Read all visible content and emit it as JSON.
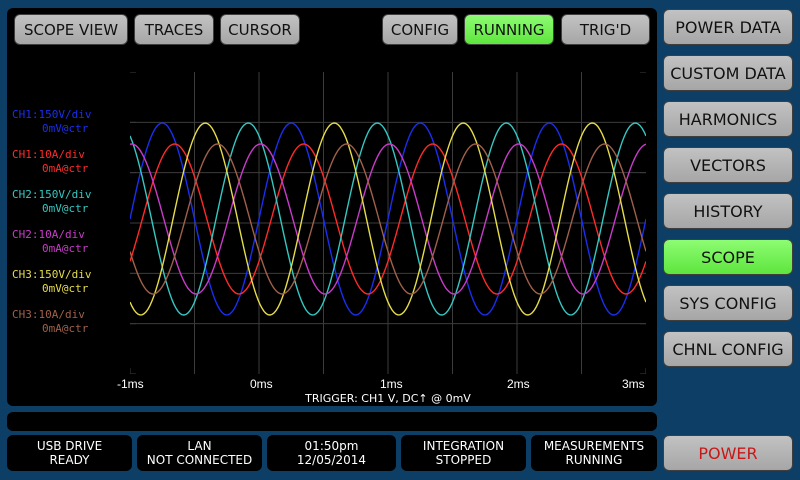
{
  "top_tabs": {
    "scope_view": "SCOPE VIEW",
    "traces": "TRACES",
    "cursor": "CURSOR",
    "config": "CONFIG",
    "running": "RUNNING",
    "trig_d": "TRIG'D"
  },
  "nav": {
    "power_data": "POWER DATA",
    "custom_data": "CUSTOM DATA",
    "harmonics": "HARMONICS",
    "vectors": "VECTORS",
    "history": "HISTORY",
    "scope": "SCOPE",
    "sys_config": "SYS CONFIG",
    "chnl_config": "CHNL CONFIG",
    "power": "POWER"
  },
  "channels": [
    {
      "id": "ch1v",
      "label": "CH1:150V/div",
      "offset": "0mV@ctr",
      "color": "#1a2ef0"
    },
    {
      "id": "ch1a",
      "label": "CH1:10A/div",
      "offset": "0mA@ctr",
      "color": "#ff2a2a"
    },
    {
      "id": "ch2v",
      "label": "CH2:150V/div",
      "offset": "0mV@ctr",
      "color": "#35c7c2"
    },
    {
      "id": "ch2a",
      "label": "CH2:10A/div",
      "offset": "0mA@ctr",
      "color": "#c93bc9"
    },
    {
      "id": "ch3v",
      "label": "CH3:150V/div",
      "offset": "0mV@ctr",
      "color": "#e6dc4a"
    },
    {
      "id": "ch3a",
      "label": "CH3:10A/div",
      "offset": "0mA@ctr",
      "color": "#a0604a"
    }
  ],
  "x_ticks": [
    "-1ms",
    "0ms",
    "1ms",
    "2ms",
    "3ms"
  ],
  "trigger": "TRIGGER: CH1 V, DC↑ @ 0mV",
  "status": {
    "usb": {
      "line1": "USB DRIVE",
      "line2": "READY"
    },
    "lan": {
      "line1": "LAN",
      "line2": "NOT CONNECTED"
    },
    "clock": {
      "line1": "01:50pm",
      "line2": "12/05/2014"
    },
    "integration": {
      "line1": "INTEGRATION",
      "line2": "STOPPED"
    },
    "measurements": {
      "line1": "MEASUREMENTS",
      "line2": "RUNNING"
    }
  },
  "colors": {
    "background": "#0d3f66",
    "button": "#b4b4b4",
    "active_button": "#6cf04e",
    "power_text": "#c81818",
    "grid": "#3c3c3c"
  }
}
